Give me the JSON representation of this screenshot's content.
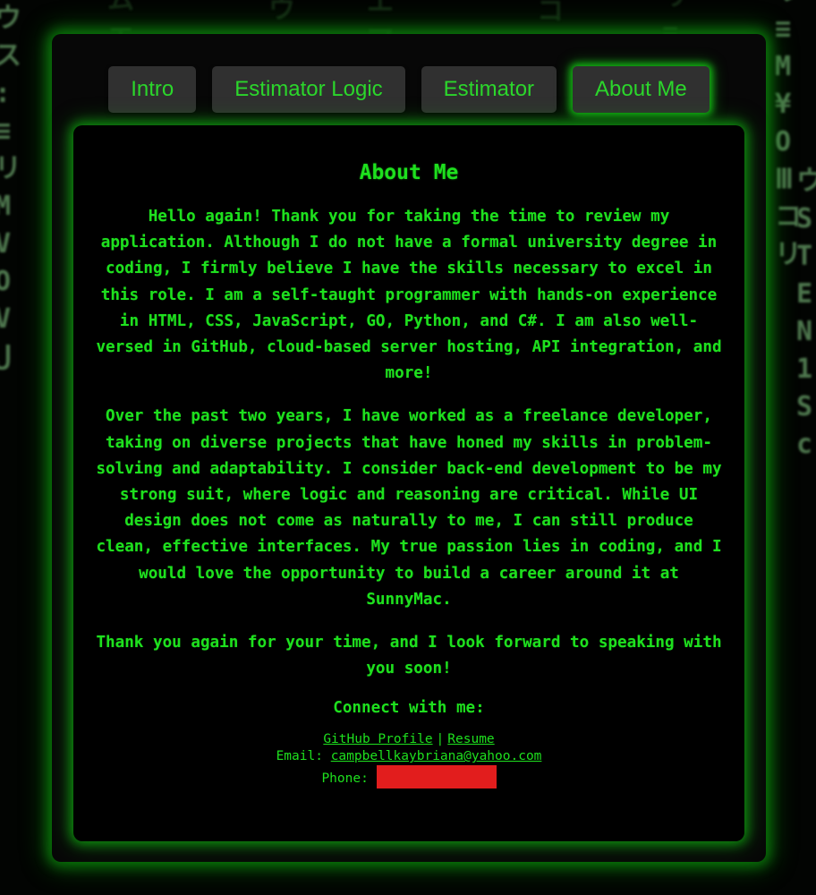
{
  "background": {
    "columns": [
      "ウ\nス\n:\n≡\nリ\nM\nV\nO\nV\nل",
      "リ\n≡\nM\n¥\nO\nⅢ\nコ\nリ",
      "リ\n≡\nM\nN\nO\nク",
      "ム\nエ\nサ\nア\n一",
      "ウ\nイ\nデ\nン",
      "エ\nマ\nソ\nウ\nO",
      "コ\nニ\nラ\nエ\nス\nI",
      "ウ\nS\nT\nE\nN\n1\nS\nс"
    ]
  },
  "tabs": [
    {
      "label": "Intro",
      "active": false
    },
    {
      "label": "Estimator Logic",
      "active": false
    },
    {
      "label": "Estimator",
      "active": false
    },
    {
      "label": "About Me",
      "active": true
    }
  ],
  "about": {
    "title": "About Me",
    "paragraphs": [
      "Hello again! Thank you for taking the time to review my application. Although I do not have a formal university degree in coding, I firmly believe I have the skills necessary to excel in this role. I am a self-taught programmer with hands-on experience in HTML, CSS, JavaScript, GO, Python, and C#. I am also well-versed in GitHub, cloud-based server hosting, API integration, and more!",
      "Over the past two years, I have worked as a freelance developer, taking on diverse projects that have honed my skills in problem-solving and adaptability. I consider back-end development to be my strong suit, where logic and reasoning are critical. While UI design does not come as naturally to me, I can still produce clean, effective interfaces. My true passion lies in coding, and I would love the opportunity to build a career around it at SunnyMac.",
      "Thank you again for your time, and I look forward to speaking with you soon!"
    ],
    "connect_heading": "Connect with me:",
    "links": {
      "github_label": "GitHub Profile",
      "separator": "|",
      "resume_label": "Resume"
    },
    "email_label": "Email:",
    "email_value": "campbellkaybriana@yahoo.com",
    "phone_label": "Phone:"
  },
  "colors": {
    "accent": "#1ee01e",
    "tab_bg": "#303030",
    "redaction": "#e21d1d"
  }
}
